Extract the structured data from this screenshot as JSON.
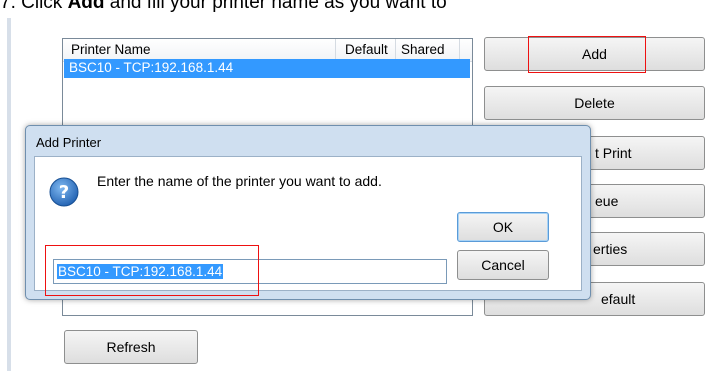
{
  "instruction": {
    "prefix": "7. Click ",
    "action": "Add",
    "suffix": " and fill your printer name as you want to"
  },
  "printer_list": {
    "columns": [
      "Printer Name",
      "Default",
      "Shared"
    ],
    "rows": [
      {
        "name": "BSC10 - TCP:192.168.1.44",
        "default": "",
        "shared": "",
        "selected": true
      }
    ]
  },
  "side_buttons": {
    "add": "Add",
    "delete": "Delete",
    "test_print": "t Print",
    "queue": "eue",
    "properties": "erties",
    "set_default": "efault"
  },
  "refresh_label": "Refresh",
  "dialog": {
    "title": "Add Printer",
    "message": "Enter the name of the printer you want to add.",
    "ok": "OK",
    "cancel": "Cancel",
    "input_value": "BSC10 - TCP:192.168.1.44",
    "icon": "question-icon"
  },
  "colors": {
    "highlight": "#e11111",
    "selection": "#3399ff",
    "dialog_frame": "#cfdff0"
  }
}
